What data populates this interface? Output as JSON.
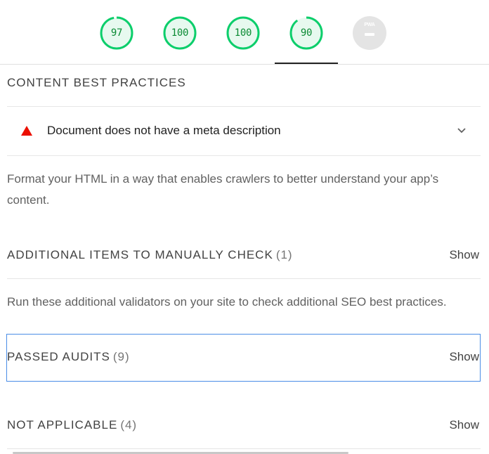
{
  "scores": [
    {
      "value": "97",
      "fraction": 0.97,
      "color": "#0cce6b"
    },
    {
      "value": "100",
      "fraction": 1.0,
      "color": "#0cce6b"
    },
    {
      "value": "100",
      "fraction": 1.0,
      "color": "#0cce6b"
    },
    {
      "value": "90",
      "fraction": 0.9,
      "color": "#0cce6b"
    }
  ],
  "pwa": {
    "label": "PWA"
  },
  "content_best_practices": {
    "title": "CONTENT BEST PRACTICES",
    "audit": {
      "label": "Document does not have a meta description",
      "status_icon": "warning-triangle-icon",
      "status_color": "#eb0f00"
    },
    "description": "Format your HTML in a way that enables crawlers to better understand your app’s content."
  },
  "manual_checks": {
    "title": "ADDITIONAL ITEMS TO MANUALLY CHECK",
    "count": "(1)",
    "show": "Show",
    "description": "Run these additional validators on your site to check additional SEO best practices."
  },
  "passed_audits": {
    "title": "PASSED AUDITS",
    "count": "(9)",
    "show": "Show"
  },
  "not_applicable": {
    "title": "NOT APPLICABLE",
    "count": "(4)",
    "show": "Show"
  }
}
